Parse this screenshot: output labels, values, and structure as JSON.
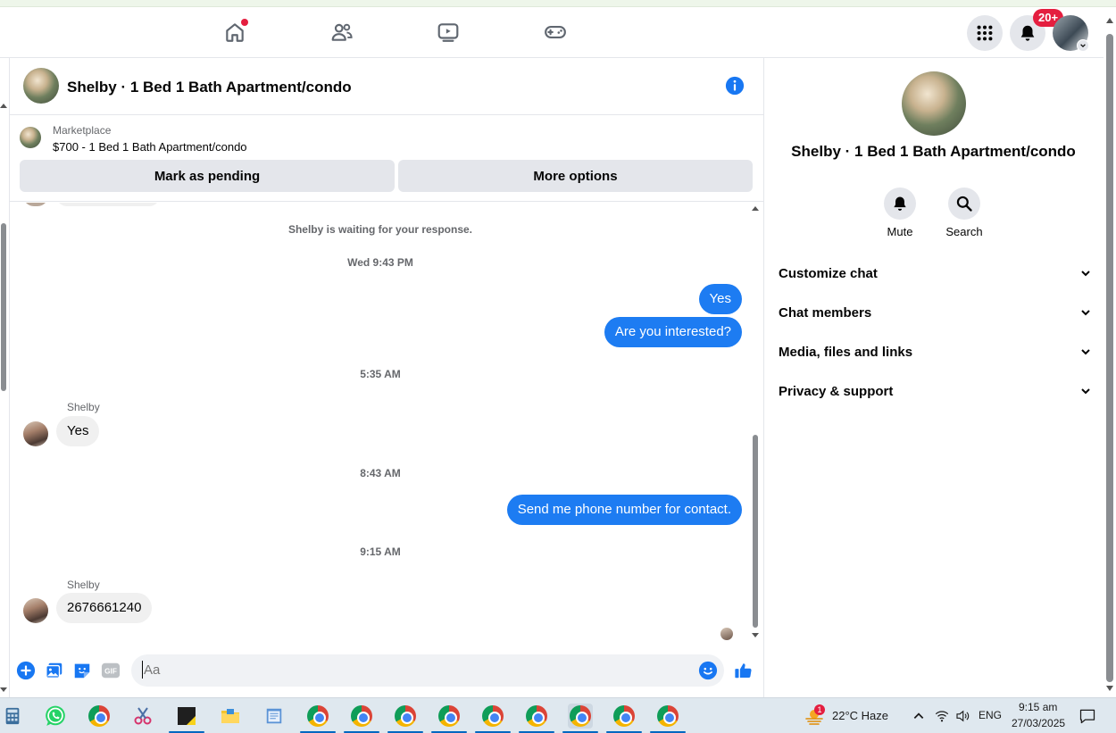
{
  "header": {
    "notification_count": "20+"
  },
  "chat": {
    "title": "Shelby · 1 Bed 1 Bath Apartment/condo",
    "marketplace_label": "Marketplace",
    "listing_price_title": "$700 - 1 Bed 1 Bath Apartment/condo",
    "mark_pending_label": "Mark as pending",
    "more_options_label": "More options",
    "waiting_notice": "Shelby is waiting for your response.",
    "messages": [
      {
        "type": "time",
        "text": "Wed 9:43 PM"
      },
      {
        "type": "out",
        "text": "Yes"
      },
      {
        "type": "out",
        "text": "Are you interested?"
      },
      {
        "type": "time",
        "text": "5:35 AM"
      },
      {
        "type": "sender",
        "text": "Shelby"
      },
      {
        "type": "in",
        "text": "Yes"
      },
      {
        "type": "time",
        "text": "8:43 AM"
      },
      {
        "type": "out",
        "text": "Send me phone number for contact."
      },
      {
        "type": "time",
        "text": "9:15 AM"
      },
      {
        "type": "sender",
        "text": "Shelby"
      },
      {
        "type": "in",
        "text": "2676661240"
      }
    ],
    "composer_placeholder": "Aa",
    "gif_label": "GIF"
  },
  "panel": {
    "title": "Shelby · 1 Bed 1 Bath Apartment/condo",
    "mute_label": "Mute",
    "search_label": "Search",
    "sections": [
      "Customize chat",
      "Chat members",
      "Media, files and links",
      "Privacy & support"
    ]
  },
  "taskbar": {
    "weather_badge": "1",
    "weather": "22°C  Haze",
    "language": "ENG",
    "time": "9:15 am",
    "date": "27/03/2025"
  },
  "colors": {
    "brand_blue": "#1d7cf2",
    "alert_red": "#e41e3f"
  }
}
